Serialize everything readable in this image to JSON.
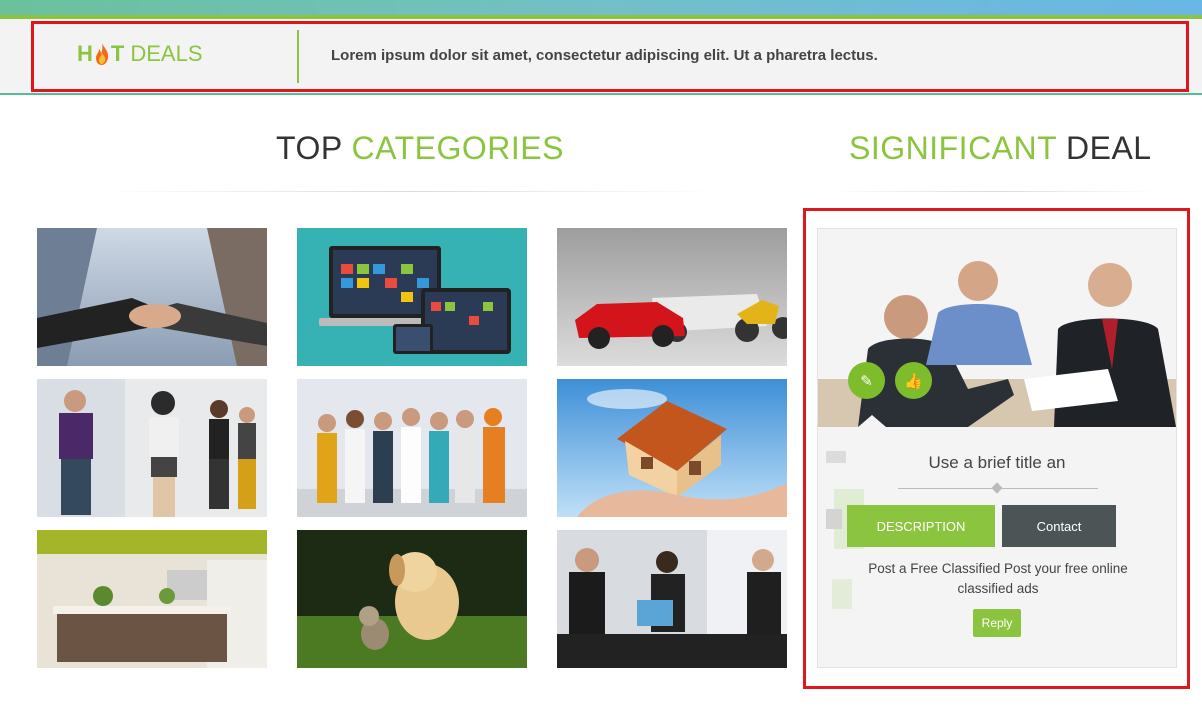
{
  "header": {
    "logo_prefix": "H",
    "logo_suffix": "T",
    "logo_word": "DEALS",
    "tagline": "Lorem ipsum dolor sit amet, consectetur adipiscing elit. Ut a pharetra lectus."
  },
  "categories_section": {
    "title_plain": "TOP",
    "title_accent": "CATEGORIES",
    "tiles": [
      {
        "name": "business-handshake"
      },
      {
        "name": "electronics-devices"
      },
      {
        "name": "vehicles"
      },
      {
        "name": "fashion"
      },
      {
        "name": "jobs"
      },
      {
        "name": "real-estate"
      },
      {
        "name": "home-kitchen"
      },
      {
        "name": "pets"
      },
      {
        "name": "services-meeting"
      }
    ]
  },
  "deal_section": {
    "title_accent": "SIGNIFICANT",
    "title_plain": "DEAL",
    "card": {
      "title": "Use a brief title an",
      "tab_description": "DESCRIPTION",
      "tab_contact": "Contact",
      "text": "Post a Free Classified Post your free online classified ads",
      "reply_label": "Reply",
      "icons": [
        "pen-icon",
        "thumbs-up-icon"
      ]
    }
  },
  "colors": {
    "accent": "#8bc53f",
    "highlight": "#e0161f",
    "dark_tab": "#4d5455"
  }
}
